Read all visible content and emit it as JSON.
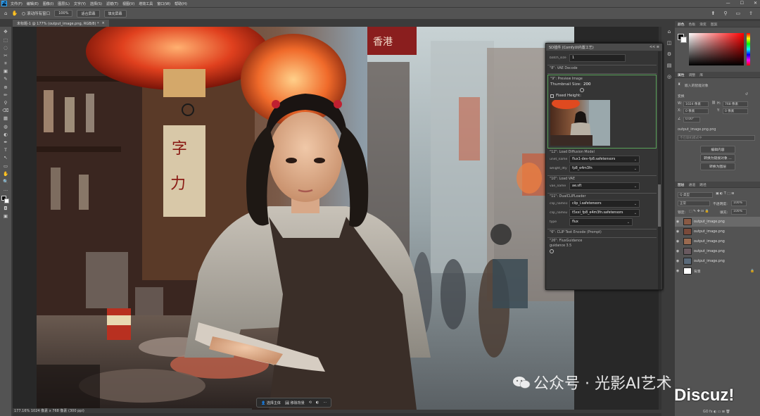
{
  "app": {
    "logo": "Ps"
  },
  "menus": [
    "文件(F)",
    "编辑(E)",
    "图像(I)",
    "图层(L)",
    "文字(Y)",
    "选择(S)",
    "滤镜(T)",
    "视图(V)",
    "增效工具",
    "窗口(W)",
    "帮助(H)"
  ],
  "window_controls": [
    "—",
    "☐",
    "✕"
  ],
  "options": {
    "scroll_all": "滚动所有窗口",
    "zoom": "100%",
    "fit_screen": "适合屏幕",
    "fill_screen": "填充屏幕"
  },
  "doc_tab": {
    "title": "未标题-1 @ 177% (output_image.png, RGB/8) *",
    "close": "×"
  },
  "tools": [
    "✥",
    "⬚",
    "◌",
    "✂",
    "⌗",
    "▣",
    "✎",
    "⊕",
    "✏",
    "⚲",
    "⌫",
    "▦",
    "◍",
    "◐",
    "✒",
    "T",
    "↖",
    "▭",
    "✋",
    "🔍",
    "…"
  ],
  "status": {
    "text": "177.16%  1024 像素 x 768 像素 (300 ppi)"
  },
  "context_bar": {
    "select_subject": "选择主体",
    "remove_bg": "移除背景",
    "more": "···"
  },
  "plugin": {
    "title": "SD插件 (ComfyUI内置工艺)",
    "head_controls": "<< ≡",
    "batch": {
      "label": "batch_size",
      "value": "1"
    },
    "nodes": {
      "vae_decode": "\"8\": VAE Decode",
      "preview": "\"9\": Preview Image",
      "thumb_size_label": "Thumbnail Size:",
      "thumb_size": "200",
      "fixed_height": "Fixed Height:",
      "load_diffusion": "\"12\": Load Diffusion Model",
      "unet_name_label": "unet_name",
      "unet_name": "flux1-dev-fp8.safetensors",
      "weight_dtype_label": "weight_dtype",
      "weight_dtype": "fp8_e4m3fn",
      "load_vae": "\"10\": Load VAE",
      "vae_name_label": "vae_name",
      "vae_name": "ae.sft",
      "dual_clip": "\"11\": DualCLIPLoader",
      "clip_name1_label": "clip_name1",
      "clip_name1": "clip_l.safetensors",
      "clip_name2_label": "clip_name2",
      "clip_name2": "t5xxl_fp8_e4m3fn.safetensors",
      "type_label": "type",
      "type": "flux",
      "clip_text": "\"6\": CLIP Text Encode (Prompt)",
      "flux_guidance": "\"26\": FluxGuidance",
      "guidance": "guidance 3.5"
    }
  },
  "side_strip": [
    "⌂",
    "◫",
    "⚙",
    "▤",
    "◎"
  ],
  "color_panel": {
    "tabs": [
      "颜色",
      "色板",
      "渐变",
      "图案"
    ]
  },
  "properties": {
    "tabs": [
      "属性",
      "调整",
      "库"
    ],
    "embedded": "嵌入的智能对象",
    "transform": "变换",
    "w_label": "W:",
    "w_value": "1024 像素",
    "h_label": "H:",
    "h_value": "768 像素",
    "x_label": "X:",
    "x_value": "0 像素",
    "y_label": "Y:",
    "y_value": "0 像素",
    "angle": "0.00°",
    "filename": "output_image.png.png",
    "linked_label": "不在联机模式中",
    "edit_content": "编辑内容",
    "convert_linked": "转换为链接对象 ...",
    "convert_layers": "转换为图层"
  },
  "layers_panel": {
    "tabs": [
      "图层",
      "通道",
      "路径"
    ],
    "kind": "Q 类型",
    "blend": "正常",
    "opacity_label": "不透明度:",
    "opacity": "100%",
    "lock_label": "锁定:",
    "fill_label": "填充:",
    "fill": "100%",
    "layers": [
      "output_image.png",
      "output_image.png",
      "output_image.png",
      "output_image.png",
      "output_image.png",
      "背景"
    ],
    "bottom_icons": "GO fx ◐ ▭ ⊞ 🗑"
  },
  "watermark": {
    "text": "公众号 · 光影AI艺术",
    "site": "Discuz!"
  }
}
